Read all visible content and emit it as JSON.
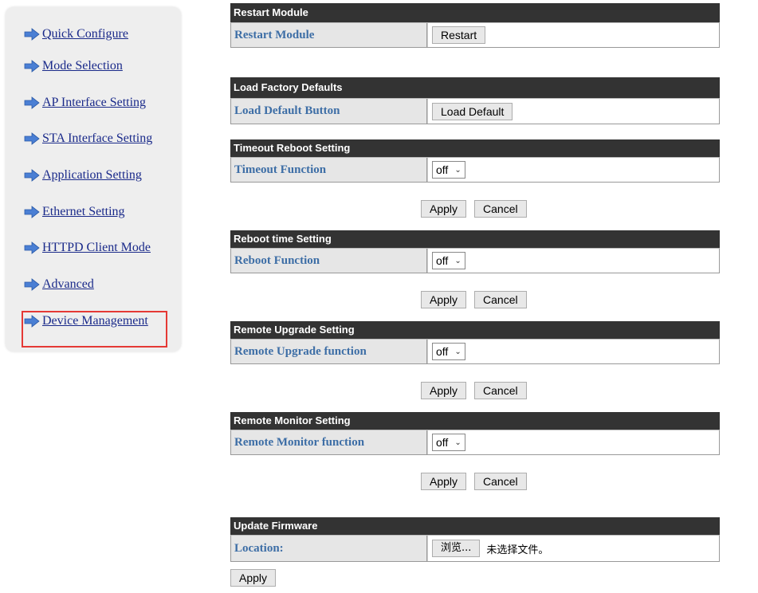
{
  "sidebar": {
    "items": [
      {
        "label": "Quick Configure"
      },
      {
        "label": "Mode Selection"
      },
      {
        "label": "AP Interface Setting"
      },
      {
        "label": "STA Interface Setting"
      },
      {
        "label": "Application Setting"
      },
      {
        "label": "Ethernet Setting"
      },
      {
        "label": "HTTPD Client Mode"
      },
      {
        "label": "Advanced"
      },
      {
        "label": "Device Management"
      }
    ]
  },
  "sections": {
    "restart": {
      "title": "Restart Module",
      "label": "Restart Module",
      "button": "Restart"
    },
    "factory": {
      "title": "Load Factory Defaults",
      "label": "Load Default Button",
      "button": "Load Default"
    },
    "timeout": {
      "title": "Timeout Reboot Setting",
      "label": "Timeout Function",
      "value": "off"
    },
    "reboot": {
      "title": "Reboot time Setting",
      "label": "Reboot Function",
      "value": "off"
    },
    "upgrade": {
      "title": "Remote Upgrade Setting",
      "label": "Remote Upgrade function",
      "value": "off"
    },
    "monitor": {
      "title": "Remote Monitor Setting",
      "label": "Remote Monitor function",
      "value": "off"
    },
    "firmware": {
      "title": "Update Firmware",
      "label": "Location:",
      "browse": "浏览...",
      "no_file": "未选择文件。"
    }
  },
  "buttons": {
    "apply": "Apply",
    "cancel": "Cancel"
  },
  "colors": {
    "header_bg": "#333333",
    "label_text": "#3d6ea6",
    "nav_link": "#1a2a8a",
    "highlight": "#e53935",
    "arrow": "#4a7fd4"
  }
}
